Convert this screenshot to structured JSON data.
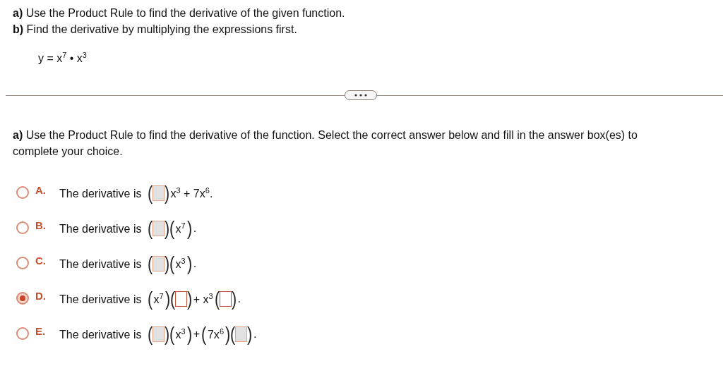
{
  "question": {
    "lines": [
      "**a)** Use the Product Rule to find the derivative of the given function.",
      "**b)** Find the derivative by multiplying the expressions first."
    ],
    "function": "y = x$^{7}$ • x$^{3}$"
  },
  "part_a": {
    "prompt": "**a)** Use the Product Rule to find the derivative of the function. Select the correct answer below and fill in the answer box(es) to complete your choice.",
    "options": [
      {
        "letter": "A.",
        "label": "The derivative is",
        "selected": false,
        "parts": [
          {
            "kind": "paren",
            "text": "("
          },
          {
            "kind": "box"
          },
          {
            "kind": "paren",
            "text": ")"
          },
          {
            "kind": "math",
            "text": "x$^{3}$ + 7x$^{6}$."
          }
        ]
      },
      {
        "letter": "B.",
        "label": "The derivative is",
        "selected": false,
        "parts": [
          {
            "kind": "paren",
            "text": "("
          },
          {
            "kind": "box"
          },
          {
            "kind": "paren",
            "text": ")"
          },
          {
            "kind": "paren",
            "text": "("
          },
          {
            "kind": "math",
            "text": "x$^{7}$"
          },
          {
            "kind": "paren",
            "text": ")"
          },
          {
            "kind": "math",
            "text": "."
          }
        ]
      },
      {
        "letter": "C.",
        "label": "The derivative is",
        "selected": false,
        "parts": [
          {
            "kind": "paren",
            "text": "("
          },
          {
            "kind": "box"
          },
          {
            "kind": "paren",
            "text": ")"
          },
          {
            "kind": "paren",
            "text": "("
          },
          {
            "kind": "math",
            "text": "x$^{3}$"
          },
          {
            "kind": "paren",
            "text": ")"
          },
          {
            "kind": "math",
            "text": "."
          }
        ]
      },
      {
        "letter": "D.",
        "label": "The derivative is",
        "selected": true,
        "parts": [
          {
            "kind": "paren",
            "text": "("
          },
          {
            "kind": "math",
            "text": "x$^{7}$"
          },
          {
            "kind": "paren",
            "text": ")"
          },
          {
            "kind": "paren",
            "text": "("
          },
          {
            "kind": "box"
          },
          {
            "kind": "paren",
            "text": ")"
          },
          {
            "kind": "math",
            "text": "+ x$^{3}$"
          },
          {
            "kind": "paren",
            "text": "("
          },
          {
            "kind": "box"
          },
          {
            "kind": "paren",
            "text": ")"
          },
          {
            "kind": "math",
            "text": "."
          }
        ]
      },
      {
        "letter": "E.",
        "label": "The derivative is",
        "selected": false,
        "parts": [
          {
            "kind": "paren",
            "text": "("
          },
          {
            "kind": "box"
          },
          {
            "kind": "paren",
            "text": ")"
          },
          {
            "kind": "paren",
            "text": "("
          },
          {
            "kind": "math",
            "text": "x$^{3}$"
          },
          {
            "kind": "paren",
            "text": ")"
          },
          {
            "kind": "math",
            "text": "+"
          },
          {
            "kind": "paren",
            "text": "("
          },
          {
            "kind": "math",
            "text": "7x$^{6}$"
          },
          {
            "kind": "paren",
            "text": ")"
          },
          {
            "kind": "paren",
            "text": "("
          },
          {
            "kind": "box"
          },
          {
            "kind": "paren",
            "text": ")"
          },
          {
            "kind": "math",
            "text": "."
          }
        ]
      }
    ]
  }
}
